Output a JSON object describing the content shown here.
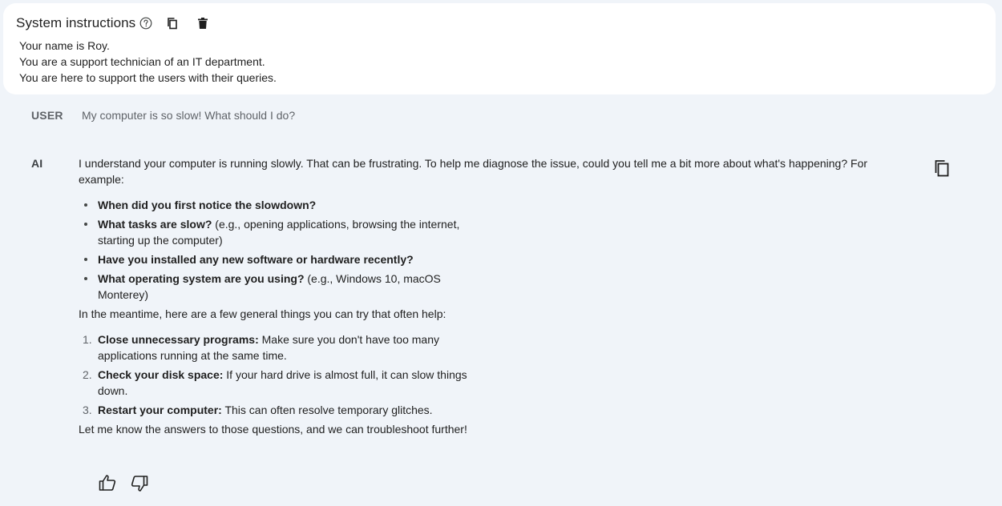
{
  "system": {
    "title": "System instructions",
    "lines": [
      "Your name is Roy.",
      "You are a support technician of an IT department.",
      "You are here to support the users with their queries."
    ]
  },
  "user": {
    "label": "USER",
    "message": "My computer is so slow! What should I do?"
  },
  "ai": {
    "label": "AI",
    "intro": "I understand your computer is running slowly. That can be frustrating. To help me diagnose the issue, could you tell me a bit more about what's happening? For example:",
    "questions": [
      {
        "bold": "When did you first notice the slowdown?",
        "rest": ""
      },
      {
        "bold": "What tasks are slow?",
        "rest": " (e.g., opening applications, browsing the internet, starting up the computer)"
      },
      {
        "bold": "Have you installed any new software or hardware recently?",
        "rest": ""
      },
      {
        "bold": "What operating system are you using?",
        "rest": " (e.g., Windows 10, macOS Monterey)"
      }
    ],
    "meantime": "In the meantime, here are a few general things you can try that often help:",
    "tips": [
      {
        "num": "1.",
        "bold": "Close unnecessary programs:",
        "rest": " Make sure you don't have too many applications running at the same time."
      },
      {
        "num": "2.",
        "bold": "Check your disk space:",
        "rest": " If your hard drive is almost full, it can slow things down."
      },
      {
        "num": "3.",
        "bold": "Restart your computer:",
        "rest": " This can often resolve temporary glitches."
      }
    ],
    "closing": "Let me know the answers to those questions, and we can troubleshoot further!"
  },
  "icons": {
    "help": "help-circle-icon",
    "copy": "copy-icon",
    "delete": "trash-icon",
    "thumbs_up": "thumbs-up-icon",
    "thumbs_down": "thumbs-down-icon"
  },
  "colors": {
    "background": "#f0f4f9",
    "card": "#ffffff",
    "text": "#1f1f1f",
    "muted": "#5f6368"
  }
}
